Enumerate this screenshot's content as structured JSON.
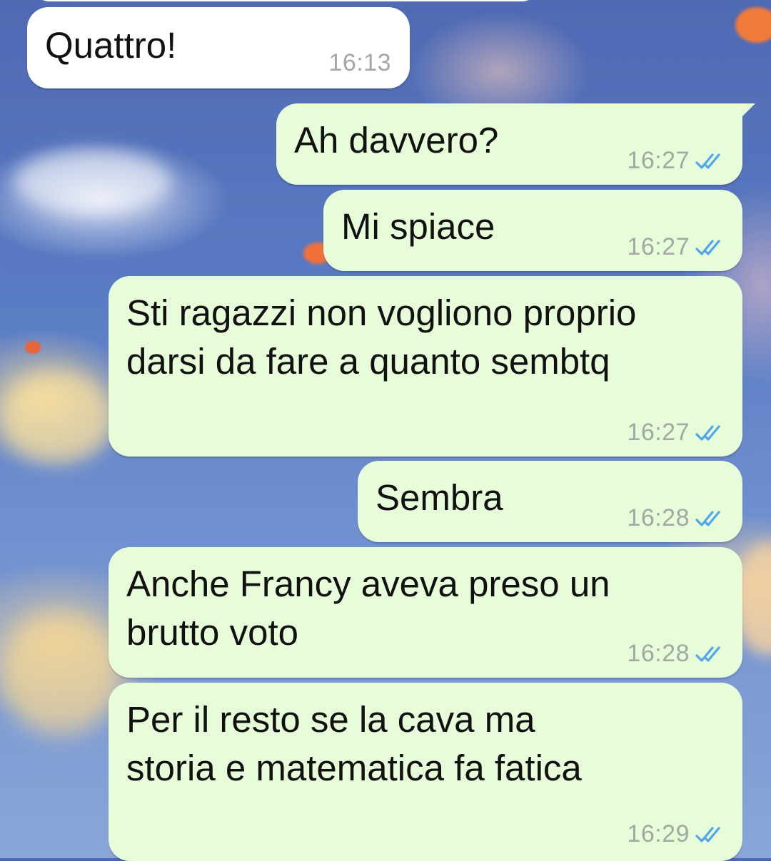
{
  "messages": [
    {
      "direction": "incoming",
      "text": "Quattro!",
      "time": "16:13"
    },
    {
      "direction": "outgoing",
      "text": "Ah davvero?",
      "time": "16:27",
      "status": "read",
      "status_icon": "double-check-icon"
    },
    {
      "direction": "outgoing",
      "text": "Mi spiace",
      "time": "16:27",
      "status": "read",
      "status_icon": "double-check-icon"
    },
    {
      "direction": "outgoing",
      "text": "Sti ragazzi non vogliono proprio\ndarsi da fare a quanto sembtq",
      "time": "16:27",
      "status": "read",
      "status_icon": "double-check-icon"
    },
    {
      "direction": "outgoing",
      "text": "Sembra",
      "time": "16:28",
      "status": "read",
      "status_icon": "double-check-icon"
    },
    {
      "direction": "outgoing",
      "text": "Anche Francy aveva preso un\nbrutto voto",
      "time": "16:28",
      "status": "read",
      "status_icon": "double-check-icon"
    },
    {
      "direction": "outgoing",
      "text": "Per il resto se la cava ma\nstoria e matematica fa fatica",
      "time": "16:29",
      "status": "read",
      "status_icon": "double-check-icon"
    }
  ],
  "colors": {
    "incoming_bubble": "#ffffff",
    "outgoing_bubble": "#e7fcd8",
    "timestamp": "#a3a8a3",
    "read_check": "#4fa6e8"
  }
}
